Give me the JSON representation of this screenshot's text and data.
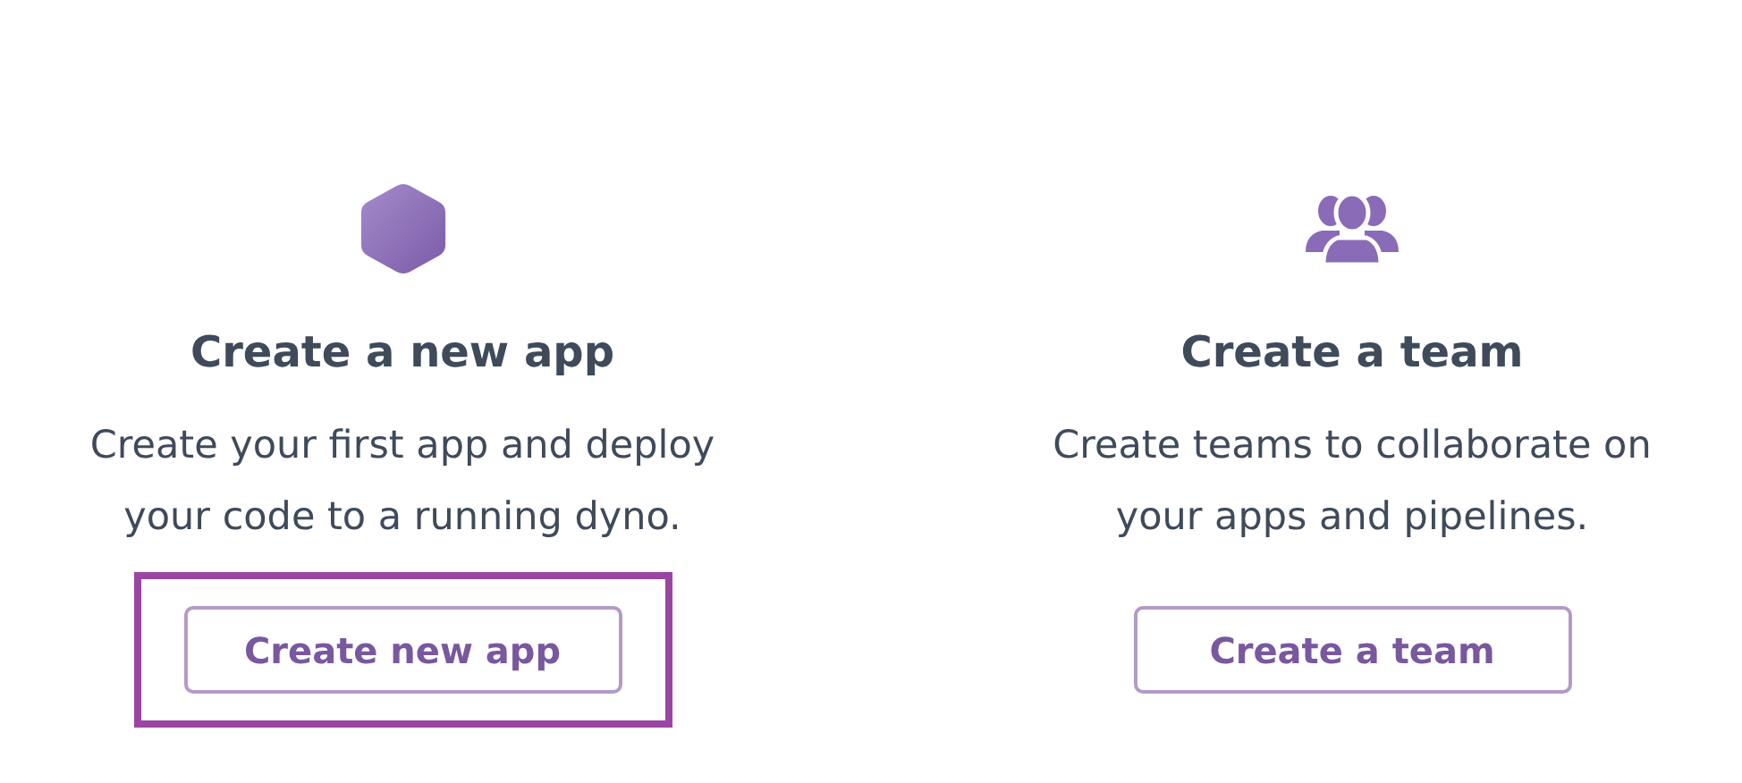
{
  "cards": [
    {
      "kind": "hexagon",
      "title": "Create a new app",
      "description": "Create your first app and deploy your code to a running dyno.",
      "button": "Create new app",
      "highlighted": true
    },
    {
      "kind": "team",
      "title": "Create a team",
      "description": "Create teams to collaborate on your apps and pipelines.",
      "button": "Create a team",
      "highlighted": false
    }
  ]
}
